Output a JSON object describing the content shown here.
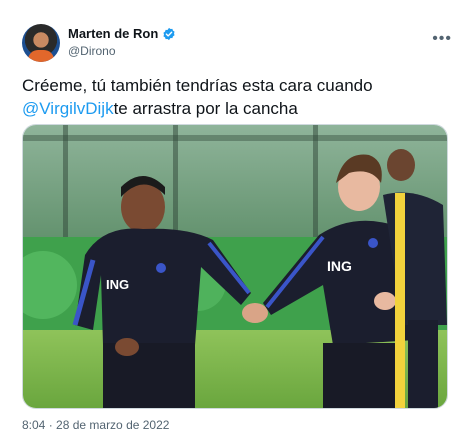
{
  "user": {
    "display_name": "Marten de Ron",
    "handle": "@Dirono",
    "verified_icon": "verified-badge-icon",
    "more_icon": "more-options-icon",
    "more_label": "•••"
  },
  "tweet": {
    "text_before": "Créeme, tú también tendrías esta cara cuando",
    "mention": "@VirgilvDijk",
    "text_after": "te arrastra por la cancha"
  },
  "photo": {
    "shirt_text_left": "ING",
    "shirt_text_right": "ING"
  },
  "meta": {
    "time": "8:04",
    "separator": " · ",
    "date": "28 de marzo de 2022"
  },
  "colors": {
    "accent": "#1d9bf0",
    "text": "#0f1419",
    "secondary": "#536471",
    "border": "#cfd9de"
  }
}
